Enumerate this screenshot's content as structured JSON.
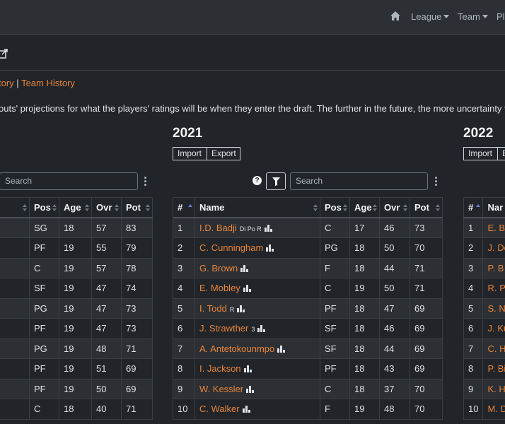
{
  "nav": {
    "league": "League",
    "team": "Team",
    "players": "Pl"
  },
  "links": {
    "history": "tory",
    "separator": "|",
    "team_history": "Team History"
  },
  "description": "outs' projections for what the players' ratings will be when they enter the draft. The further in the future, the more uncertainty th",
  "search_placeholder": "Search",
  "buttons": {
    "import": "Import",
    "export": "Export",
    "export_partial": "E"
  },
  "help_glyph": "?",
  "left_table": {
    "headers": [
      "",
      "Pos",
      "Age",
      "Ovr",
      "Pot"
    ],
    "rows": [
      [
        "SG",
        "18",
        "57",
        "83"
      ],
      [
        "PF",
        "19",
        "55",
        "79"
      ],
      [
        "C",
        "19",
        "57",
        "78"
      ],
      [
        "SF",
        "19",
        "47",
        "74"
      ],
      [
        "PG",
        "19",
        "47",
        "73"
      ],
      [
        "PF",
        "19",
        "47",
        "73"
      ],
      [
        "PG",
        "19",
        "48",
        "71"
      ],
      [
        "PF",
        "19",
        "51",
        "69"
      ],
      [
        "PF",
        "19",
        "50",
        "69"
      ],
      [
        "C",
        "18",
        "40",
        "71"
      ]
    ]
  },
  "year_2021": {
    "year": "2021",
    "headers": [
      "#",
      "Name",
      "Pos",
      "Age",
      "Ovr",
      "Pot"
    ],
    "rows": [
      {
        "rank": "1",
        "name": "I.D. Badji",
        "skills": "Di Po R",
        "pos": "C",
        "age": "17",
        "ovr": "46",
        "pot": "73"
      },
      {
        "rank": "2",
        "name": "C. Cunningham",
        "skills": "",
        "pos": "PG",
        "age": "18",
        "ovr": "50",
        "pot": "70"
      },
      {
        "rank": "3",
        "name": "G. Brown",
        "skills": "",
        "pos": "F",
        "age": "18",
        "ovr": "44",
        "pot": "71"
      },
      {
        "rank": "4",
        "name": "E. Mobley",
        "skills": "",
        "pos": "C",
        "age": "19",
        "ovr": "50",
        "pot": "71"
      },
      {
        "rank": "5",
        "name": "I. Todd",
        "skills": "R",
        "pos": "PF",
        "age": "18",
        "ovr": "47",
        "pot": "69"
      },
      {
        "rank": "6",
        "name": "J. Strawther",
        "skills": "3",
        "pos": "SF",
        "age": "18",
        "ovr": "46",
        "pot": "69"
      },
      {
        "rank": "7",
        "name": "A. Antetokounmpo",
        "skills": "",
        "pos": "SF",
        "age": "18",
        "ovr": "44",
        "pot": "69"
      },
      {
        "rank": "8",
        "name": "I. Jackson",
        "skills": "",
        "pos": "PF",
        "age": "18",
        "ovr": "43",
        "pot": "69"
      },
      {
        "rank": "9",
        "name": "W. Kessler",
        "skills": "",
        "pos": "C",
        "age": "18",
        "ovr": "37",
        "pot": "70"
      },
      {
        "rank": "10",
        "name": "C. Walker",
        "skills": "",
        "pos": "F",
        "age": "19",
        "ovr": "48",
        "pot": "70"
      }
    ]
  },
  "year_2022": {
    "year": "2022",
    "headers": [
      "#",
      "Nar"
    ],
    "rows": [
      {
        "rank": "1",
        "name": "E. Ba"
      },
      {
        "rank": "2",
        "name": "J. Dc"
      },
      {
        "rank": "3",
        "name": "P. B"
      },
      {
        "rank": "4",
        "name": "R. P"
      },
      {
        "rank": "5",
        "name": "S. N"
      },
      {
        "rank": "6",
        "name": "J. Ku"
      },
      {
        "rank": "7",
        "name": "C. H"
      },
      {
        "rank": "8",
        "name": "P. Bi"
      },
      {
        "rank": "9",
        "name": "K. H"
      },
      {
        "rank": "10",
        "name": "M. D"
      }
    ]
  }
}
